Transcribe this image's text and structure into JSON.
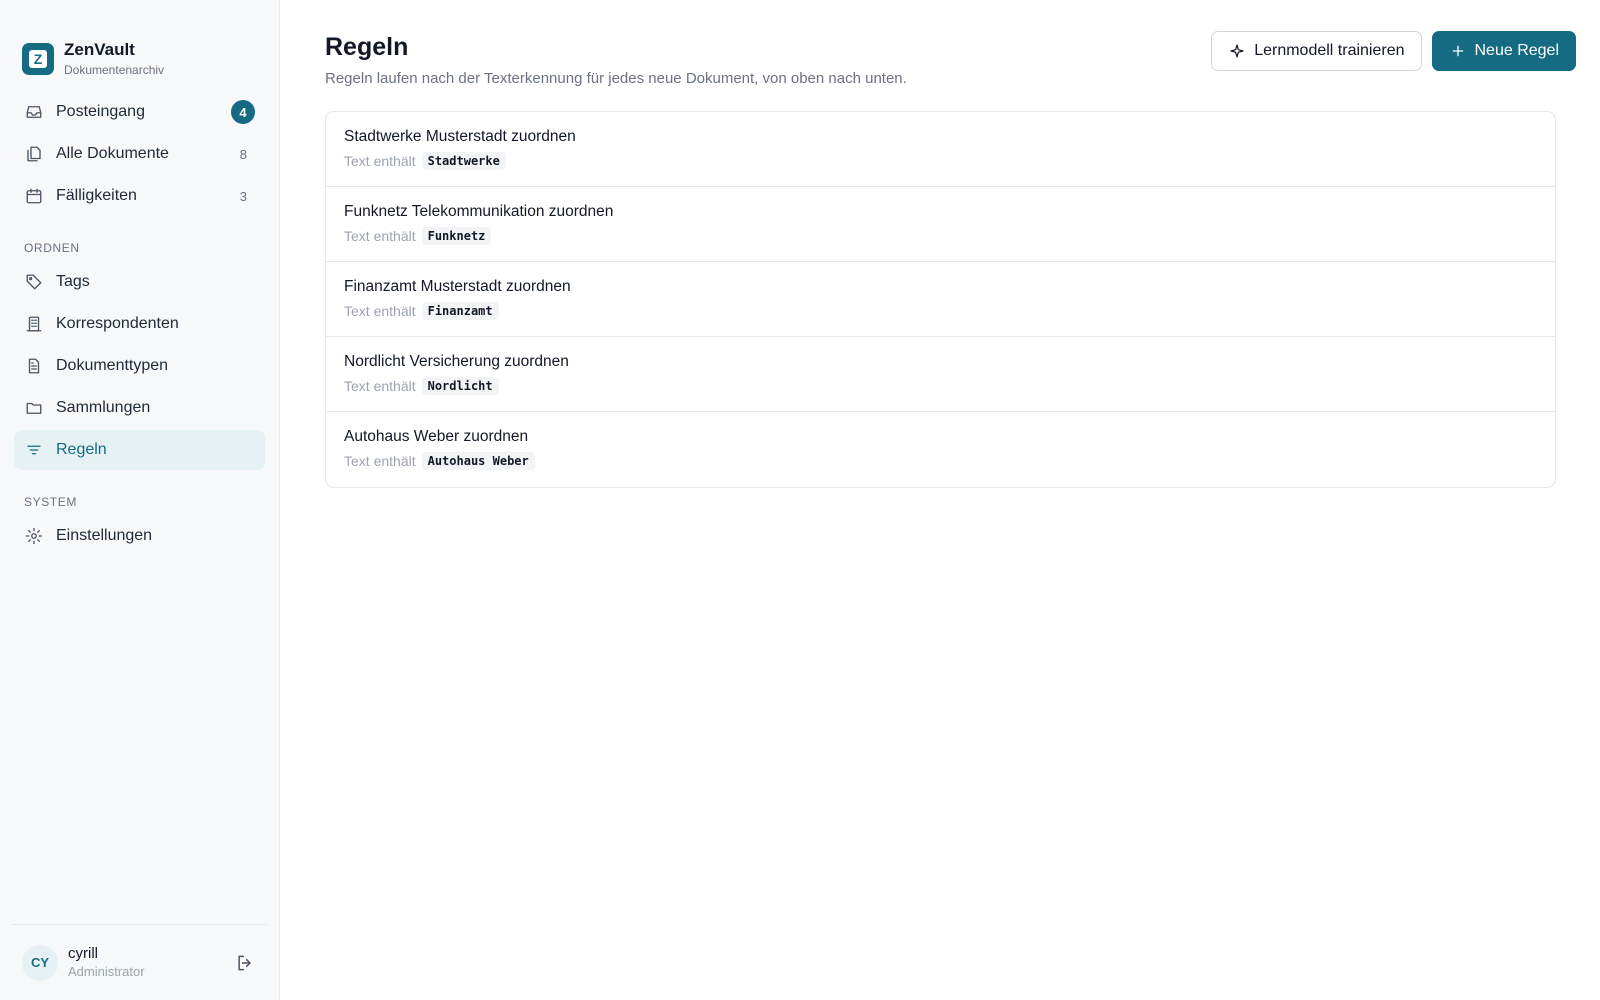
{
  "brand": {
    "name": "ZenVault",
    "subtitle": "Dokumentenarchiv",
    "logo_letter": "Z"
  },
  "nav": {
    "main": [
      {
        "label": "Posteingang",
        "icon": "inbox-icon",
        "badge": "4"
      },
      {
        "label": "Alle Dokumente",
        "icon": "documents-icon",
        "count": "8"
      },
      {
        "label": "Fälligkeiten",
        "icon": "calendar-icon",
        "count": "3"
      }
    ],
    "section_organize": "ORDNEN",
    "organize": [
      {
        "label": "Tags",
        "icon": "tag-icon"
      },
      {
        "label": "Korrespondenten",
        "icon": "building-icon"
      },
      {
        "label": "Dokumenttypen",
        "icon": "file-text-icon"
      },
      {
        "label": "Sammlungen",
        "icon": "folder-icon"
      },
      {
        "label": "Regeln",
        "icon": "filter-icon",
        "active": true
      }
    ],
    "section_system": "SYSTEM",
    "system": [
      {
        "label": "Einstellungen",
        "icon": "gear-icon"
      }
    ]
  },
  "user": {
    "initials": "CY",
    "name": "cyrill",
    "role": "Administrator"
  },
  "page": {
    "title": "Regeln",
    "description": "Regeln laufen nach der Texterkennung für jedes neue Dokument, von oben nach unten.",
    "train_button": "Lernmodell trainieren",
    "new_rule_button": "Neue Regel"
  },
  "rules": [
    {
      "name": "Stadtwerke Musterstadt zuordnen",
      "condition_label": "Text enthält",
      "condition_value": "Stadtwerke"
    },
    {
      "name": "Funknetz Telekommunikation zuordnen",
      "condition_label": "Text enthält",
      "condition_value": "Funknetz"
    },
    {
      "name": "Finanzamt Musterstadt zuordnen",
      "condition_label": "Text enthält",
      "condition_value": "Finanzamt"
    },
    {
      "name": "Nordlicht Versicherung zuordnen",
      "condition_label": "Text enthält",
      "condition_value": "Nordlicht"
    },
    {
      "name": "Autohaus Weber zuordnen",
      "condition_label": "Text enthält",
      "condition_value": "Autohaus Weber"
    }
  ],
  "colors": {
    "accent": "#156b82",
    "active_bg": "#e6f1f4",
    "sidebar_bg": "#f6f8fa"
  }
}
